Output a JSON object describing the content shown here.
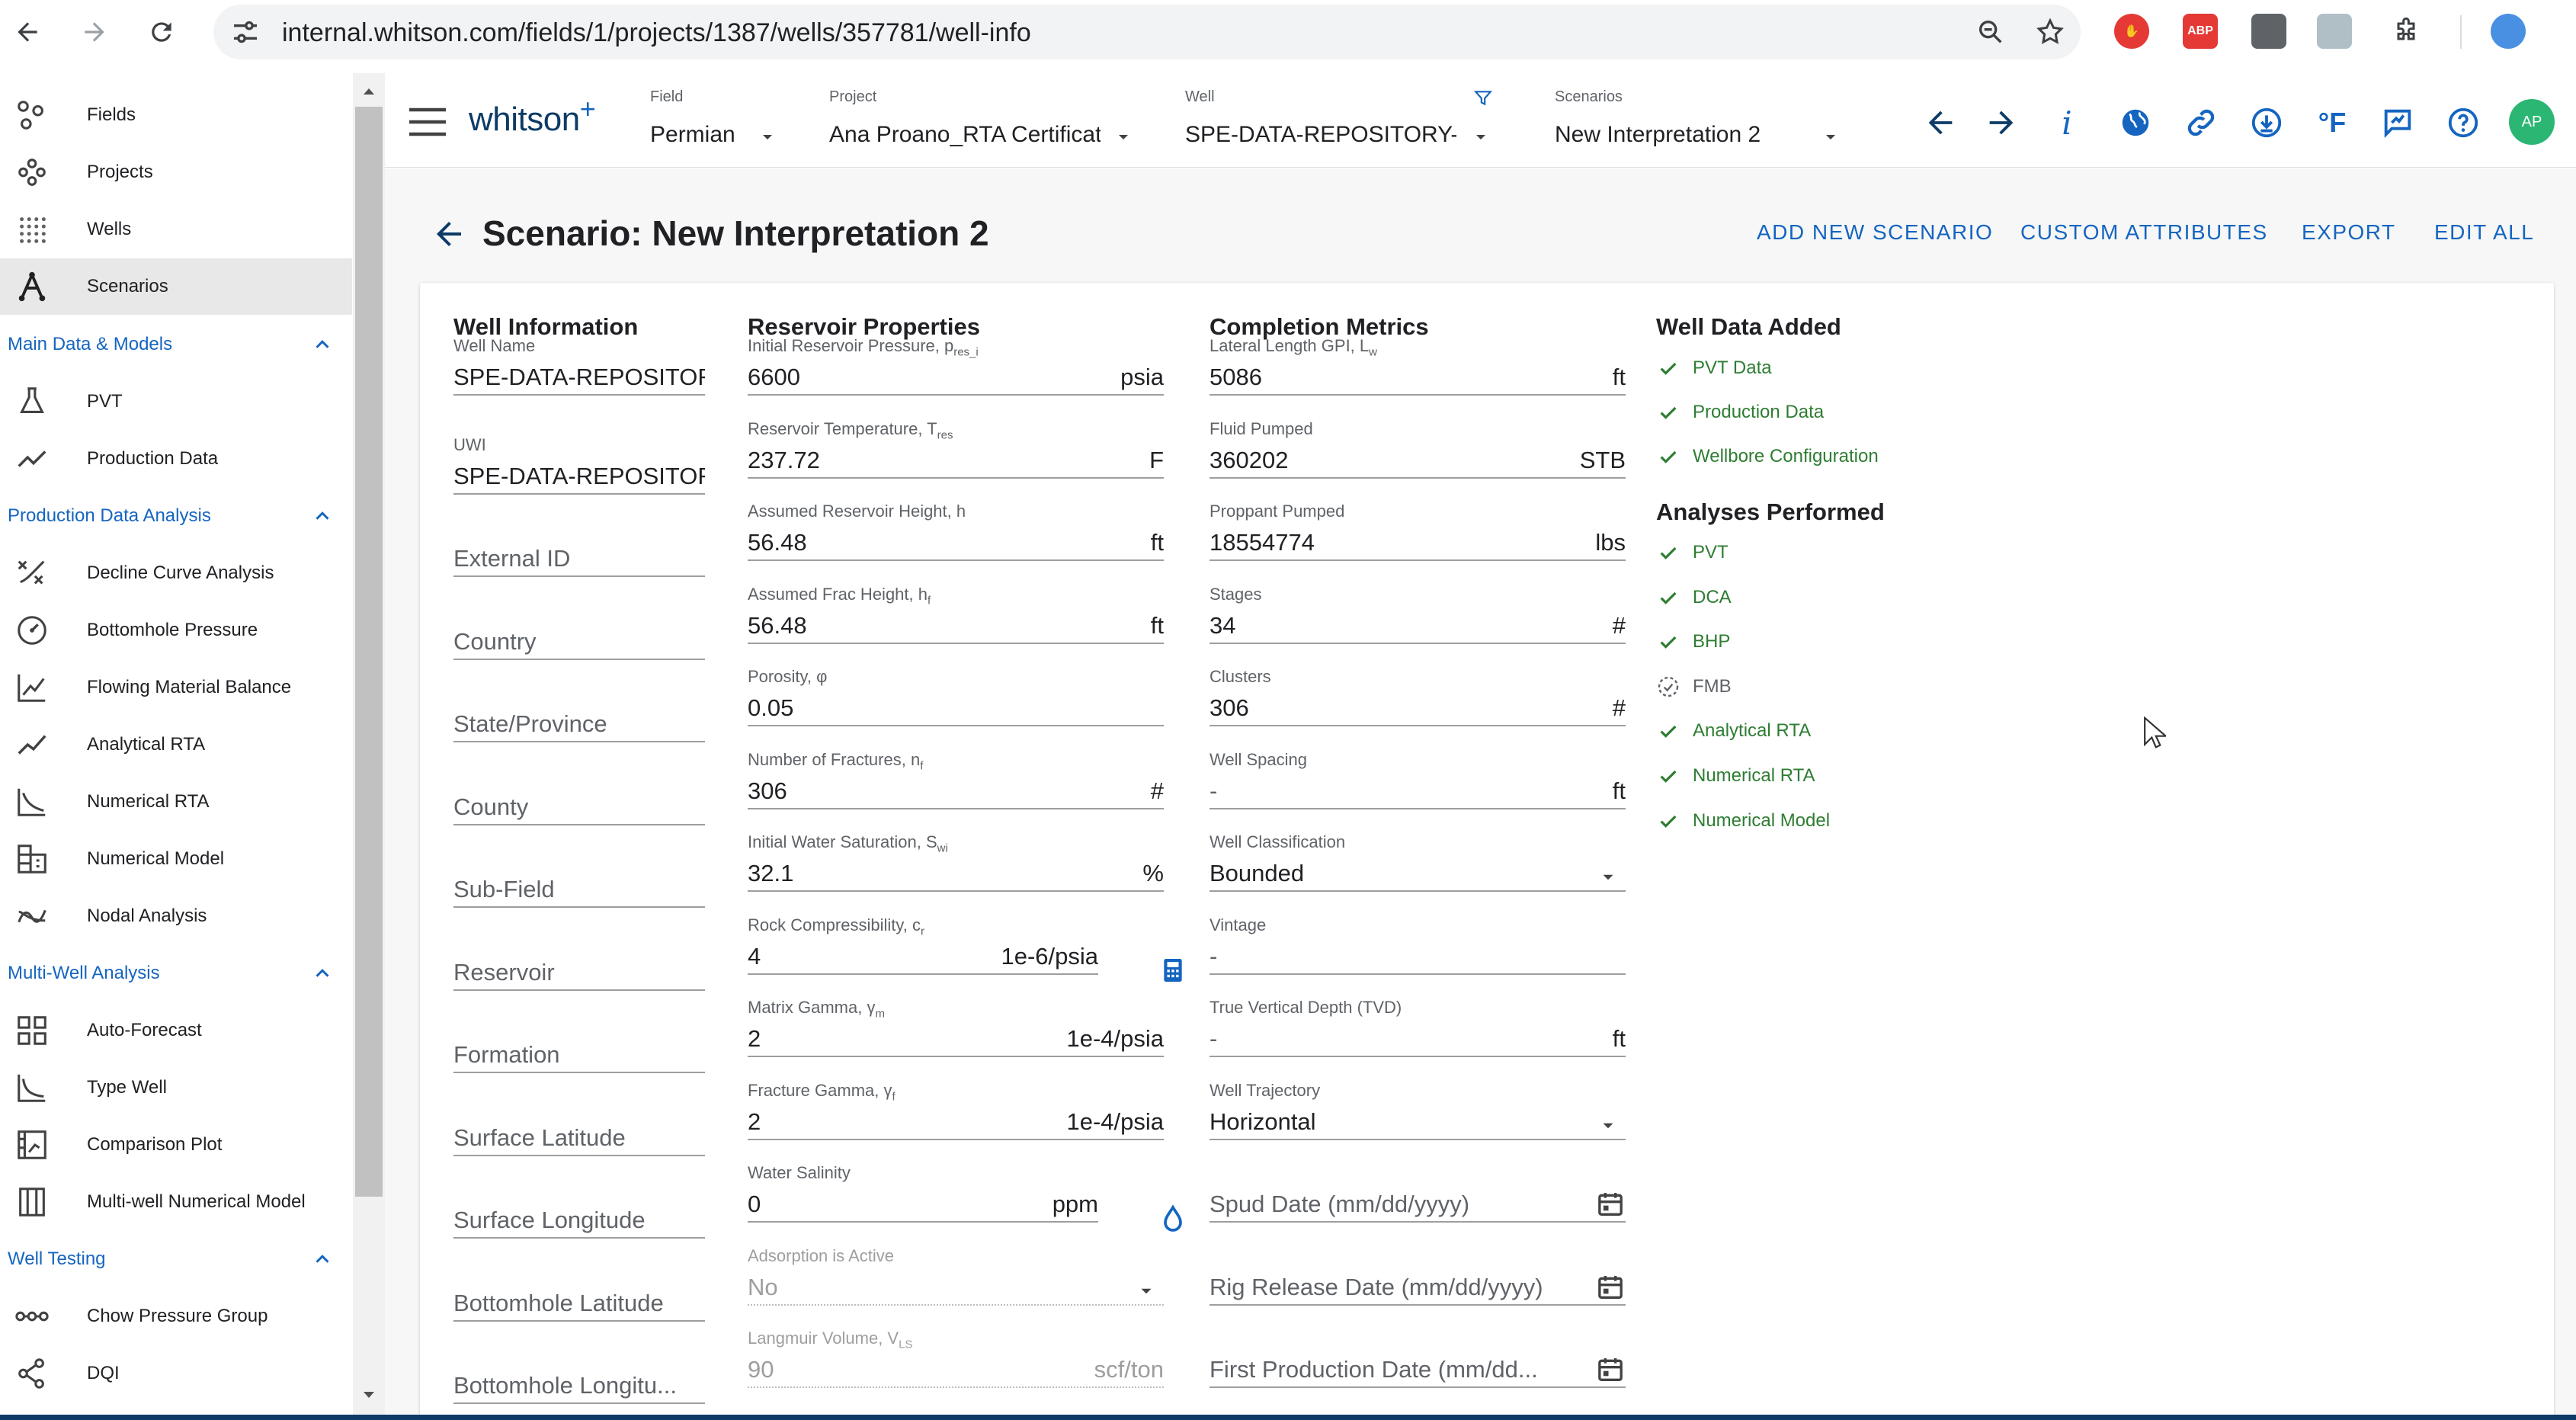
{
  "browser": {
    "url": "internal.whitson.com/fields/1/projects/1387/wells/357781/well-info"
  },
  "sidebar": {
    "top_items": [
      {
        "label": "Fields",
        "icon": "fields-icon"
      },
      {
        "label": "Projects",
        "icon": "projects-icon"
      },
      {
        "label": "Wells",
        "icon": "wells-icon"
      },
      {
        "label": "Scenarios",
        "icon": "scenarios-icon"
      }
    ],
    "groups": [
      {
        "label": "Main Data & Models",
        "items": [
          {
            "label": "PVT",
            "icon": "flask-icon"
          },
          {
            "label": "Production Data",
            "icon": "trend-line-icon"
          }
        ]
      },
      {
        "label": "Production Data Analysis",
        "items": [
          {
            "label": "Decline Curve Analysis",
            "icon": "decline-curve-icon"
          },
          {
            "label": "Bottomhole Pressure",
            "icon": "gauge-icon"
          },
          {
            "label": "Flowing Material Balance",
            "icon": "material-balance-icon"
          },
          {
            "label": "Analytical RTA",
            "icon": "analytical-rta-icon"
          },
          {
            "label": "Numerical RTA",
            "icon": "numerical-rta-icon"
          },
          {
            "label": "Numerical Model",
            "icon": "grid-model-icon"
          },
          {
            "label": "Nodal Analysis",
            "icon": "nodal-analysis-icon"
          }
        ]
      },
      {
        "label": "Multi-Well Analysis",
        "items": [
          {
            "label": "Auto-Forecast",
            "icon": "auto-forecast-icon"
          },
          {
            "label": "Type Well",
            "icon": "type-well-icon"
          },
          {
            "label": "Comparison Plot",
            "icon": "comparison-plot-icon"
          },
          {
            "label": "Multi-well Numerical Model",
            "icon": "multiwell-model-icon"
          }
        ]
      },
      {
        "label": "Well Testing",
        "items": [
          {
            "label": "Chow Pressure Group",
            "icon": "chow-pressure-icon"
          },
          {
            "label": "DQI",
            "icon": "dqi-icon"
          }
        ]
      }
    ]
  },
  "header": {
    "logo": "whitson",
    "logo_plus": "+",
    "field": {
      "label": "Field",
      "value": "Permian"
    },
    "project": {
      "label": "Project",
      "value": "Ana Proano_RTA Certificat"
    },
    "well": {
      "label": "Well",
      "value": "SPE-DATA-REPOSITORY-DA"
    },
    "scenarios": {
      "label": "Scenarios",
      "value": "New Interpretation 2"
    },
    "units_label": "°F",
    "info_label": "i",
    "avatar": "AP"
  },
  "page": {
    "title": "Scenario: New Interpretation 2",
    "actions": {
      "add": "ADD NEW SCENARIO",
      "custom": "CUSTOM ATTRIBUTES",
      "export": "EXPORT",
      "edit": "EDIT ALL"
    }
  },
  "well_info": {
    "title": "Well Information",
    "well_name": {
      "label": "Well Name",
      "value": "SPE-DATA-REPOSITORY-"
    },
    "uwi": {
      "label": "UWI",
      "value": "SPE-DATA-REPOSITORY-"
    },
    "placeholders": [
      "External ID",
      "Country",
      "State/Province",
      "County",
      "Sub-Field",
      "Reservoir",
      "Formation",
      "Surface Latitude",
      "Surface Longitude",
      "Bottomhole Latitude",
      "Bottomhole Longitu..."
    ]
  },
  "reservoir": {
    "title": "Reservoir Properties",
    "fields": [
      {
        "label": "Initial Reservoir Pressure, p",
        "sub": "res_i",
        "value": "6600",
        "unit": "psia"
      },
      {
        "label": "Reservoir Temperature, T",
        "sub": "res",
        "value": "237.72",
        "unit": "F"
      },
      {
        "label": "Assumed Reservoir Height, h",
        "sub": "",
        "value": "56.48",
        "unit": "ft"
      },
      {
        "label": "Assumed Frac Height, h",
        "sub": "f",
        "value": "56.48",
        "unit": "ft"
      },
      {
        "label": "Porosity, φ",
        "sub": "",
        "value": "0.05",
        "unit": ""
      },
      {
        "label": "Number of Fractures, n",
        "sub": "f",
        "value": "306",
        "unit": "#"
      },
      {
        "label": "Initial Water Saturation, S",
        "sub": "wi",
        "value": "32.1",
        "unit": "%"
      },
      {
        "label": "Rock Compressibility, c",
        "sub": "r",
        "value": "4",
        "unit": "1e-6/psia"
      },
      {
        "label": "Matrix Gamma, γ",
        "sub": "m",
        "value": "2",
        "unit": "1e-4/psia"
      },
      {
        "label": "Fracture Gamma, γ",
        "sub": "f",
        "value": "2",
        "unit": "1e-4/psia"
      },
      {
        "label": "Water Salinity",
        "sub": "",
        "value": "0",
        "unit": "ppm"
      },
      {
        "label": "Adsorption is Active",
        "sub": "",
        "value": "No",
        "unit": ""
      },
      {
        "label": "Langmuir Volume, V",
        "sub": "LS",
        "value": "90",
        "unit": "scf/ton"
      }
    ]
  },
  "completion": {
    "title": "Completion Metrics",
    "fields": [
      {
        "label": "Lateral Length GPI, L",
        "sub": "w",
        "value": "5086",
        "unit": "ft"
      },
      {
        "label": "Fluid Pumped",
        "sub": "",
        "value": "360202",
        "unit": "STB"
      },
      {
        "label": "Proppant Pumped",
        "sub": "",
        "value": "18554774",
        "unit": "lbs"
      },
      {
        "label": "Stages",
        "sub": "",
        "value": "34",
        "unit": "#"
      },
      {
        "label": "Clusters",
        "sub": "",
        "value": "306",
        "unit": "#"
      },
      {
        "label": "Well Spacing",
        "sub": "",
        "value": "-",
        "unit": "ft"
      },
      {
        "label": "Well Classification",
        "sub": "",
        "value": "Bounded",
        "unit": ""
      },
      {
        "label": "Vintage",
        "sub": "",
        "value": "-",
        "unit": ""
      },
      {
        "label": "True Vertical Depth (TVD)",
        "sub": "",
        "value": "-",
        "unit": "ft"
      },
      {
        "label": "Well Trajectory",
        "sub": "",
        "value": "Horizontal",
        "unit": ""
      }
    ],
    "dates": [
      "Spud Date (mm/dd/yyyy)",
      "Rig Release Date (mm/dd/yyyy)",
      "First Production Date (mm/dd..."
    ]
  },
  "well_data": {
    "title": "Well Data Added",
    "items": [
      "PVT Data",
      "Production Data",
      "Wellbore Configuration"
    ]
  },
  "analyses": {
    "title": "Analyses Performed",
    "items": [
      {
        "label": "PVT",
        "status": "done"
      },
      {
        "label": "DCA",
        "status": "done"
      },
      {
        "label": "BHP",
        "status": "done"
      },
      {
        "label": "FMB",
        "status": "pending"
      },
      {
        "label": "Analytical RTA",
        "status": "done"
      },
      {
        "label": "Numerical RTA",
        "status": "done"
      },
      {
        "label": "Numerical Model",
        "status": "done"
      }
    ]
  },
  "colors": {
    "accent": "#1565c0",
    "success": "#2e7d32",
    "avatar": "#2bb673",
    "brand": "#0d3b66"
  }
}
